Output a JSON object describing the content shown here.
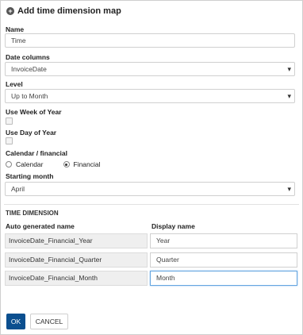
{
  "dialog": {
    "title": "Add time dimension map",
    "name_label": "Name",
    "name_value": "Time",
    "date_columns_label": "Date columns",
    "date_columns_value": "InvoiceDate",
    "level_label": "Level",
    "level_value": "Up to Month",
    "week_of_year_label": "Use Week of Year",
    "week_of_year_checked": false,
    "day_of_year_label": "Use Day of Year",
    "day_of_year_checked": false,
    "calendar_label": "Calendar / financial",
    "calendar_option": "Calendar",
    "financial_option": "Financial",
    "selected_calendar": "Financial",
    "starting_month_label": "Starting month",
    "starting_month_value": "April",
    "time_dimension_title": "TIME DIMENSION",
    "col_auto": "Auto generated name",
    "col_display": "Display name",
    "rows": [
      {
        "auto": "InvoiceDate_Financial_Year",
        "display": "Year"
      },
      {
        "auto": "InvoiceDate_Financial_Quarter",
        "display": "Quarter"
      },
      {
        "auto": "InvoiceDate_Financial_Month",
        "display": "Month"
      }
    ],
    "ok_label": "OK",
    "cancel_label": "CANCEL"
  }
}
